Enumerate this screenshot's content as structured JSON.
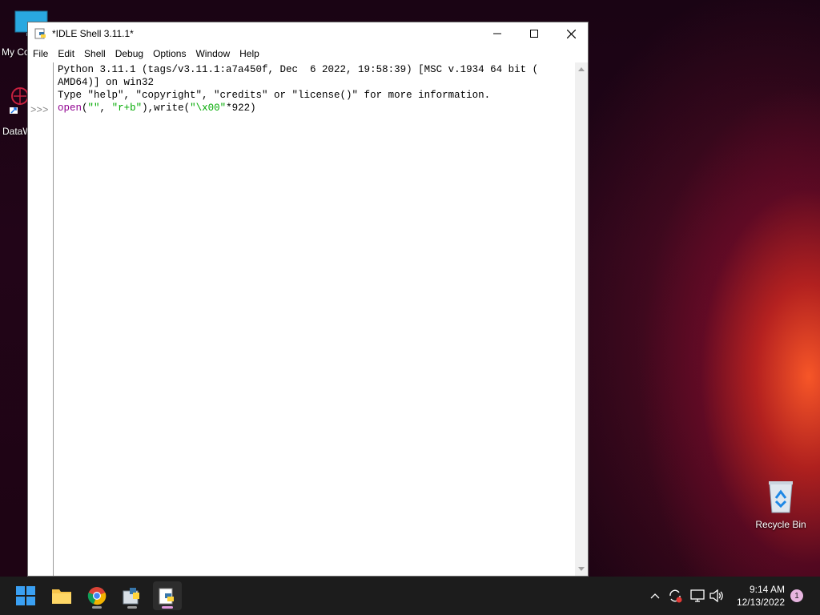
{
  "desktop": {
    "icons": [
      {
        "label": "My Co",
        "icon": "computer-icon"
      },
      {
        "label": "DataW",
        "icon": "app-shortcut-icon"
      },
      {
        "label": "Recycle Bin",
        "icon": "recycle-bin-icon"
      }
    ]
  },
  "window": {
    "title": "*IDLE Shell 3.11.1*",
    "menu": [
      "File",
      "Edit",
      "Shell",
      "Debug",
      "Options",
      "Window",
      "Help"
    ],
    "controls": {
      "minimize": "minimize-icon",
      "maximize": "maximize-icon",
      "close": "close-icon"
    }
  },
  "shell": {
    "banner_line1": "Python 3.11.1 (tags/v3.11.1:a7a450f, Dec  6 2022, 19:58:39) [MSC v.1934 64 bit (",
    "banner_line2": "AMD64)] on win32",
    "banner_line3": "Type \"help\", \"copyright\", \"credits\" or \"license()\" for more information.",
    "prompt": ">>>",
    "input": {
      "open": "open",
      "p1": "(",
      "s1": "\"\"",
      "p2": ", ",
      "s2": "\"r+b\"",
      "p3": "),write(",
      "s3": "\"\\x00\"",
      "p4": "*922)"
    }
  },
  "taskbar": {
    "apps": [
      "start-icon",
      "file-explorer-icon",
      "chrome-icon",
      "python-setup-icon",
      "idle-icon"
    ],
    "clock_time": "9:14 AM",
    "clock_date": "12/13/2022",
    "notification_count": "1"
  }
}
